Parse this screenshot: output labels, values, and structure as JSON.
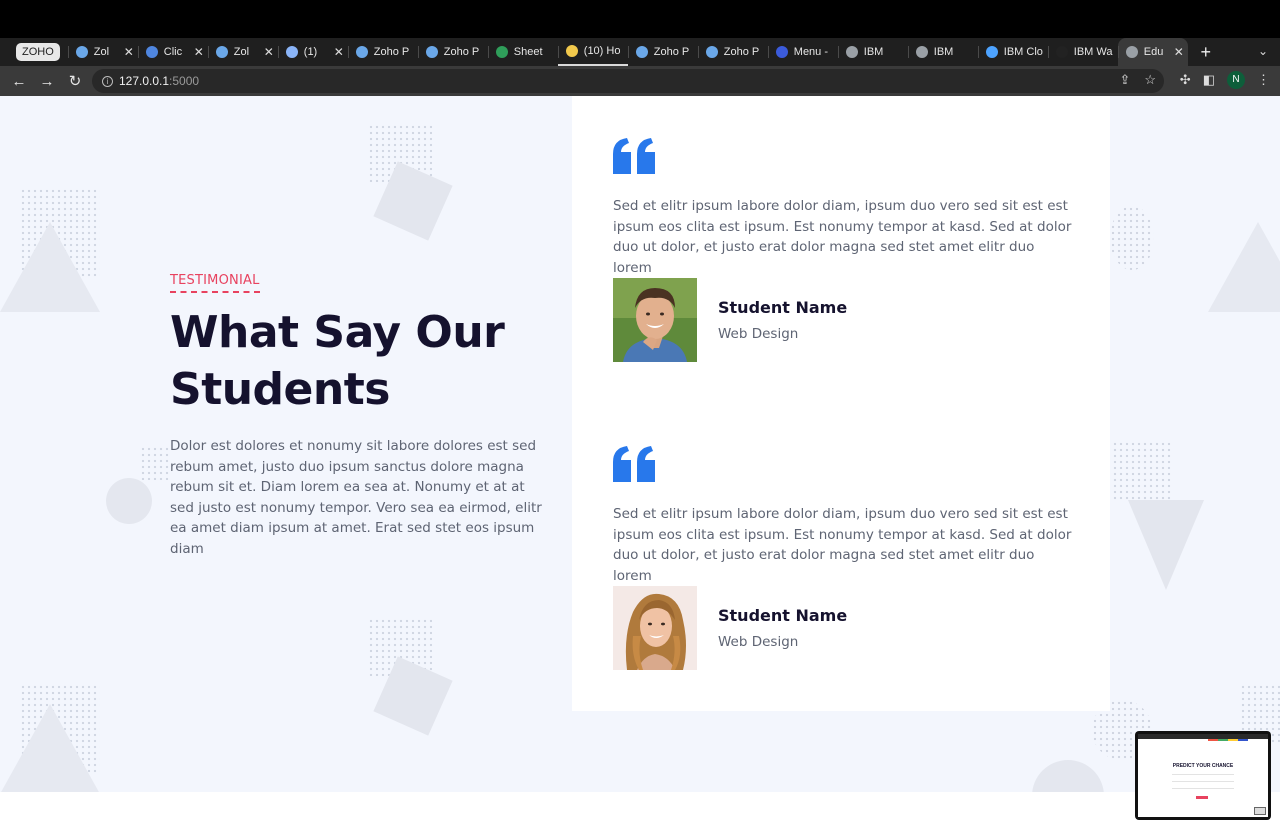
{
  "browser": {
    "tab_group_label": "ZOHO",
    "tabs": [
      {
        "title": "Zol",
        "icon": "zoho-icon",
        "color": "#6aa7e8",
        "closable": true
      },
      {
        "title": "Clic",
        "icon": "chat-icon",
        "color": "#4f86e0",
        "closable": true
      },
      {
        "title": "Zol",
        "icon": "zoho-icon",
        "color": "#6aa7e8",
        "closable": true
      },
      {
        "title": "(1)",
        "icon": "mail-icon",
        "color": "#8ab4f8",
        "closable": true
      },
      {
        "title": "Zoho P",
        "icon": "zoho-icon",
        "color": "#6aa7e8",
        "closable": false
      },
      {
        "title": "Zoho P",
        "icon": "zoho-icon",
        "color": "#6aa7e8",
        "closable": false
      },
      {
        "title": "Sheet",
        "icon": "sheet-icon",
        "color": "#2f9e5a",
        "closable": false
      },
      {
        "title": "(10) Ho",
        "icon": "hootsuite-icon",
        "color": "#f2c94c",
        "closable": false
      },
      {
        "title": "Zoho P",
        "icon": "zoho-icon",
        "color": "#6aa7e8",
        "closable": false
      },
      {
        "title": "Zoho P",
        "icon": "zoho-icon",
        "color": "#6aa7e8",
        "closable": false
      },
      {
        "title": "Menu -",
        "icon": "zc-icon",
        "color": "#3b5bdb",
        "closable": false
      },
      {
        "title": "IBM",
        "icon": "globe-icon",
        "color": "#9aa0a6",
        "closable": false
      },
      {
        "title": "IBM",
        "icon": "globe-icon",
        "color": "#9aa0a6",
        "closable": false
      },
      {
        "title": "IBM Clo",
        "icon": "ibm-cloud-icon",
        "color": "#4da3ff",
        "closable": false
      },
      {
        "title": "IBM Wa",
        "icon": "github-icon",
        "color": "#222222",
        "closable": false
      },
      {
        "title": "Edu",
        "icon": "globe-icon",
        "color": "#9aa0a6",
        "closable": true,
        "active": true
      }
    ],
    "url_host": "127.0.0.1",
    "url_port": ":5000",
    "profile_initial": "N"
  },
  "page": {
    "eyebrow": "TESTIMONIAL",
    "headline": "What Say Our Students",
    "lead": "Dolor est dolores et nonumy sit labore dolores est sed rebum amet, justo duo ipsum sanctus dolore magna rebum sit et. Diam lorem ea sea at. Nonumy et at at sed justo est nonumy tempor. Vero sea ea eirmod, elitr ea amet diam ipsum at amet. Erat sed stet eos ipsum diam",
    "accent_color": "#e8425f",
    "quote_color": "#2878eb",
    "testimonials": [
      {
        "text": "Sed et elitr ipsum labore dolor diam, ipsum duo vero sed sit est est ipsum eos clita est ipsum. Est nonumy tempor at kasd. Sed at dolor duo ut dolor, et justo erat dolor magna sed stet amet elitr duo lorem",
        "name": "Student Name",
        "role": "Web Design",
        "photo": "student-male-photo"
      },
      {
        "text": "Sed et elitr ipsum labore dolor diam, ipsum duo vero sed sit est est ipsum eos clita est ipsum. Est nonumy tempor at kasd. Sed at dolor duo ut dolor, et justo erat dolor magna sed stet amet elitr duo lorem",
        "name": "Student Name",
        "role": "Web Design",
        "photo": "student-female-photo"
      }
    ]
  },
  "pip": {
    "title": "PREDICT YOUR CHANCE"
  }
}
